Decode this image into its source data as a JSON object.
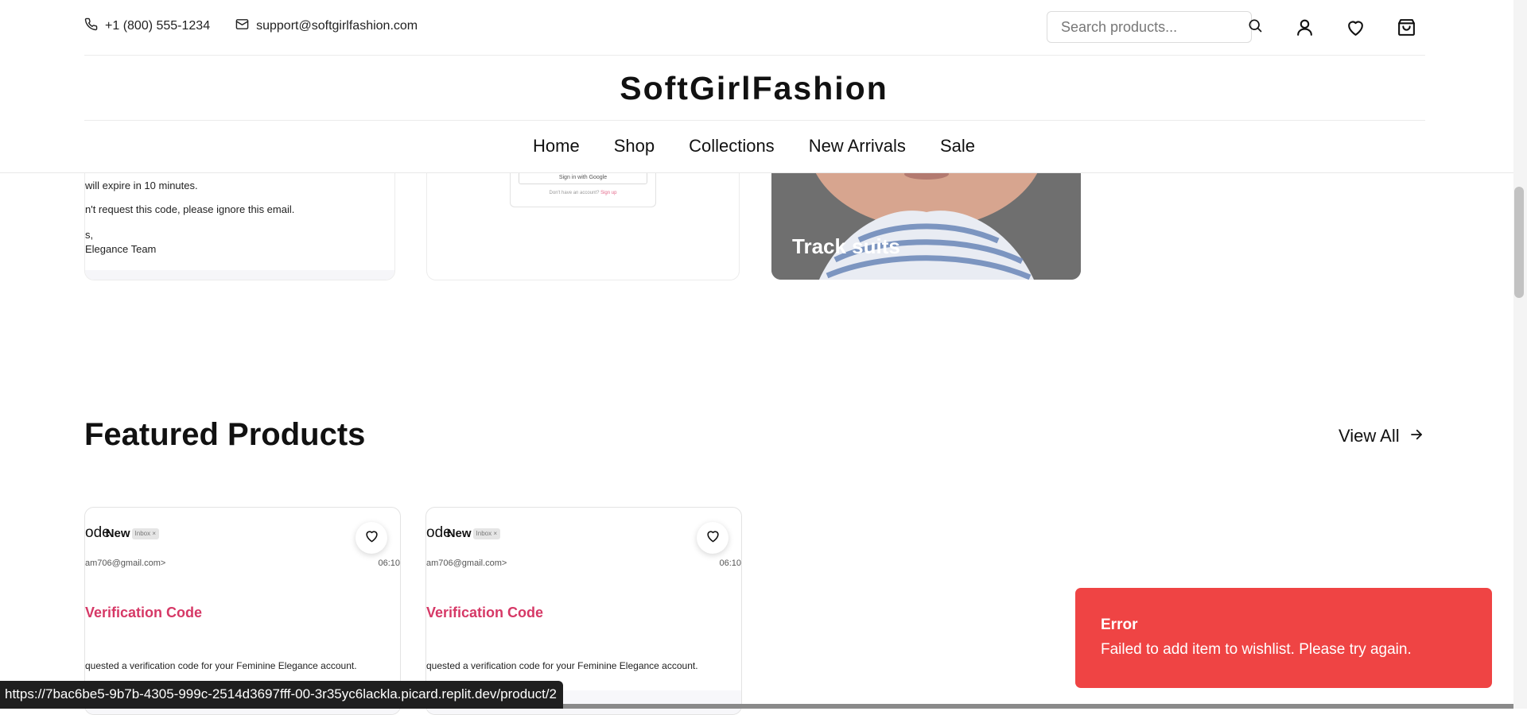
{
  "header": {
    "phone": "+1 (800) 555-1234",
    "email": "support@softgirlfashion.com",
    "search_placeholder": "Search products...",
    "brand": "SoftGirlFashion",
    "nav": [
      "Home",
      "Shop",
      "Collections",
      "New Arrivals",
      "Sale"
    ]
  },
  "collections": {
    "card1_lines": [
      "will expire in 10 minutes.",
      "n't request this code, please ignore this email.",
      "s,",
      "Elegance Team"
    ],
    "card2_google": "Sign in with Google",
    "card2_link_text": "Don't have an account?",
    "card2_link": "Sign up",
    "card3_label": "Track suits"
  },
  "featured": {
    "title": "Featured Products",
    "view_all": "View All",
    "products": [
      {
        "top_text": "ode",
        "badge": "New",
        "chip": "Inbox ×",
        "from": "am706@gmail.com>",
        "time": "06:10",
        "title": "Verification Code",
        "body": "quested a verification code for your Feminine Elegance account."
      },
      {
        "top_text": "ode",
        "badge": "New",
        "chip": "Inbox ×",
        "from": "am706@gmail.com>",
        "time": "06:10",
        "title": "Verification Code",
        "body": "quested a verification code for your Feminine Elegance account."
      }
    ]
  },
  "toast": {
    "title": "Error",
    "message": "Failed to add item to wishlist. Please try again.",
    "color": "#ef4444"
  },
  "status_bar": {
    "url": "https://7bac6be5-9b7b-4305-999c-2514d3697fff-00-3r35yc6lackla.picard.replit.dev/product/2"
  }
}
